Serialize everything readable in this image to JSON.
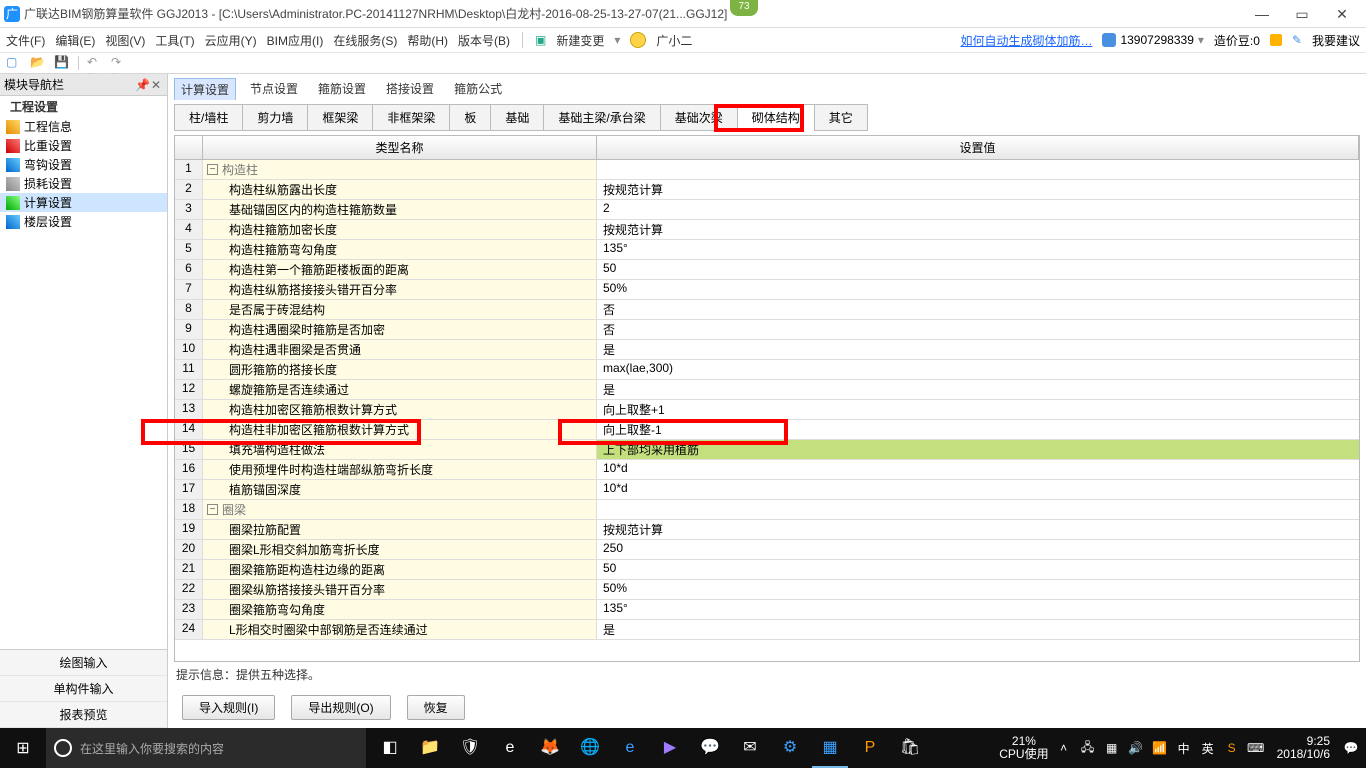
{
  "titlebar": {
    "app_icon": "广",
    "title": "广联达BIM钢筋算量软件 GGJ2013 - [C:\\Users\\Administrator.PC-20141127NRHM\\Desktop\\白龙村-2016-08-25-13-27-07(21...GGJ12]",
    "badge": "73"
  },
  "menubar": {
    "items": [
      "文件(F)",
      "编辑(E)",
      "视图(V)",
      "工具(T)",
      "云应用(Y)",
      "BIM应用(I)",
      "在线服务(S)",
      "帮助(H)",
      "版本号(B)"
    ],
    "new_change": "新建变更",
    "qq_name": "广小二",
    "right_link": "如何自动生成砌体加筋…",
    "user": "13907298339",
    "cost_label": "造价豆:0",
    "feedback": "我要建议"
  },
  "sidebar": {
    "panel_title": "模块导航栏",
    "section": "工程设置",
    "items": [
      {
        "label": "工程信息"
      },
      {
        "label": "比重设置"
      },
      {
        "label": "弯钩设置"
      },
      {
        "label": "损耗设置"
      },
      {
        "label": "计算设置"
      },
      {
        "label": "楼层设置"
      }
    ],
    "footer": [
      "绘图输入",
      "单构件输入",
      "报表预览"
    ]
  },
  "tabs1": [
    "计算设置",
    "节点设置",
    "箍筋设置",
    "搭接设置",
    "箍筋公式"
  ],
  "tabs2": [
    "柱/墙柱",
    "剪力墙",
    "框架梁",
    "非框架梁",
    "板",
    "基础",
    "基础主梁/承台梁",
    "基础次梁",
    "砌体结构",
    "其它"
  ],
  "table": {
    "headers": {
      "name": "类型名称",
      "value": "设置值"
    },
    "rows": [
      {
        "num": "1",
        "group": true,
        "name": "构造柱",
        "value": ""
      },
      {
        "num": "2",
        "name": "构造柱纵筋露出长度",
        "value": "按规范计算"
      },
      {
        "num": "3",
        "name": "基础锚固区内的构造柱箍筋数量",
        "value": "2"
      },
      {
        "num": "4",
        "name": "构造柱箍筋加密长度",
        "value": "按规范计算"
      },
      {
        "num": "5",
        "name": "构造柱箍筋弯勾角度",
        "value": "135°"
      },
      {
        "num": "6",
        "name": "构造柱第一个箍筋距楼板面的距离",
        "value": "50"
      },
      {
        "num": "7",
        "name": "构造柱纵筋搭接接头错开百分率",
        "value": "50%"
      },
      {
        "num": "8",
        "name": "是否属于砖混结构",
        "value": "否"
      },
      {
        "num": "9",
        "name": "构造柱遇圈梁时箍筋是否加密",
        "value": "否"
      },
      {
        "num": "10",
        "name": "构造柱遇非圈梁是否贯通",
        "value": "是"
      },
      {
        "num": "11",
        "name": "圆形箍筋的搭接长度",
        "value": "max(lae,300)"
      },
      {
        "num": "12",
        "name": "螺旋箍筋是否连续通过",
        "value": "是"
      },
      {
        "num": "13",
        "name": "构造柱加密区箍筋根数计算方式",
        "value": "向上取整+1"
      },
      {
        "num": "14",
        "name": "构造柱非加密区箍筋根数计算方式",
        "value": "向上取整-1"
      },
      {
        "num": "15",
        "name": "填充墙构造柱做法",
        "value": "上下部均采用植筋",
        "highlight": true
      },
      {
        "num": "16",
        "name": "使用预埋件时构造柱端部纵筋弯折长度",
        "value": "10*d"
      },
      {
        "num": "17",
        "name": "植筋锚固深度",
        "value": "10*d"
      },
      {
        "num": "18",
        "group": true,
        "name": "圈梁",
        "value": ""
      },
      {
        "num": "19",
        "name": "圈梁拉筋配置",
        "value": "按规范计算"
      },
      {
        "num": "20",
        "name": "圈梁L形相交斜加筋弯折长度",
        "value": "250"
      },
      {
        "num": "21",
        "name": "圈梁箍筋距构造柱边缘的距离",
        "value": "50"
      },
      {
        "num": "22",
        "name": "圈梁纵筋搭接接头错开百分率",
        "value": "50%"
      },
      {
        "num": "23",
        "name": "圈梁箍筋弯勾角度",
        "value": "135°"
      },
      {
        "num": "24",
        "name": "L形相交时圈梁中部钢筋是否连续通过",
        "value": "是"
      }
    ]
  },
  "hint": "提示信息：提供五种选择。",
  "buttons": {
    "import": "导入规则(I)",
    "export": "导出规则(O)",
    "restore": "恢复"
  },
  "taskbar": {
    "search_placeholder": "在这里输入你要搜索的内容",
    "cpu_pct": "21%",
    "cpu_label": "CPU使用",
    "ime1": "中",
    "ime2": "英",
    "time": "9:25",
    "date": "2018/10/6"
  }
}
